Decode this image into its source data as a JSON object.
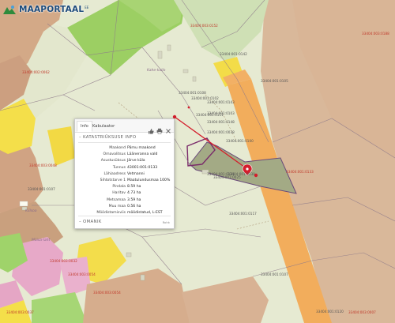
{
  "app": {
    "title": "MAAPORTAAL",
    "title_sup": "EE"
  },
  "map": {
    "parcel_numbers": [
      "33404:001:0108",
      "33404:001:0102",
      "33404:001:0143",
      "33404:001:0103",
      "33404:001:0111",
      "33404:001:0148",
      "33404:001:0038",
      "33404:001:0100",
      "33404:001:0131",
      "33404:001:0130",
      "33404:001:0107",
      "33404:001:0117",
      "33404:001:0116",
      "33404:001:0142",
      "33404:001:0105",
      "33404:001:0107",
      "33404:001:0120",
      "33404:001:0025"
    ],
    "red_labels": [
      "33404:003:0152",
      "33404:003:0188",
      "33404:002:0062",
      "33404:003:0048",
      "33404:003:0032",
      "33404:003:0054",
      "33404:003:0054",
      "33404:003:0037",
      "33404:003:0007"
    ],
    "orange_labels": [
      "33404:001:0133"
    ],
    "place_labels": [
      "Kahe-kallo",
      "Kiilsoo",
      "Mõisa-laht"
    ]
  },
  "popup": {
    "tabs": [
      "Info",
      "Kabulaator"
    ],
    "tools": [
      "thumb-icon",
      "print-icon",
      "close-icon"
    ],
    "section_title": "KATASTRIÜKSUSE INFO",
    "rows": [
      {
        "k": "Maakond",
        "v": "Pärnu maakond"
      },
      {
        "k": "Omavalitsus",
        "v": "Lääneranna vald"
      },
      {
        "k": "Asustusüksus",
        "v": "Järve küla"
      },
      {
        "k": "Tunnus",
        "v": "43001:001:0133"
      },
      {
        "k": "Lähiaadress",
        "v": "Vetmanni"
      },
      {
        "k": "Sihtotstarve 1",
        "v": "Maatulundusmaa 100%"
      },
      {
        "k": "Pindala",
        "v": "8.59 ha"
      },
      {
        "k": "Haritav",
        "v": "4.73 ha"
      },
      {
        "k": "Metsamaa",
        "v": "3.59 ha"
      },
      {
        "k": "Muu maa",
        "v": "0.56 ha"
      },
      {
        "k": "Mõõdistamisviis",
        "v": "mõõdistatud, L-EST"
      }
    ],
    "more_label": "Rohk",
    "owner_section": "OMANIK"
  }
}
